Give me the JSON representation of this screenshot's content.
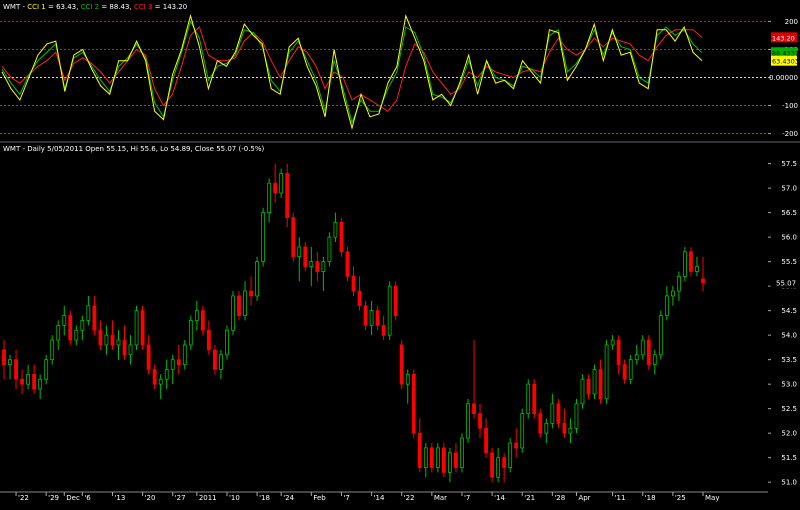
{
  "chart_data": [
    {
      "type": "line",
      "title_parts": [
        {
          "text": "WMT - ",
          "color": "#ffffff"
        },
        {
          "text": "CCI 1",
          "color": "#ffff00"
        },
        {
          "text": " = 63.43, ",
          "color": "#ffffff"
        },
        {
          "text": "CCI 2",
          "color": "#00c000"
        },
        {
          "text": " = 88.43, ",
          "color": "#ffffff"
        },
        {
          "text": "CCI 3",
          "color": "#ff2020"
        },
        {
          "text": " = 143.20",
          "color": "#ffffff"
        }
      ],
      "ylim": [
        -230,
        255
      ],
      "y_ticks": [
        "200",
        "100",
        "0.00000",
        "-100",
        "-200"
      ],
      "ref_lines": [
        {
          "value": 200,
          "color": "#ff2020"
        },
        {
          "value": 100,
          "color": "#ff2020"
        },
        {
          "value": 0,
          "color": "#ffffff"
        },
        {
          "value": -100,
          "color": "#00c000"
        },
        {
          "value": -200,
          "color": "#00c000"
        }
      ],
      "last_value_tags": [
        {
          "text": "143.20",
          "value": 143.2,
          "bg": "#e00000",
          "fg": "#ffffff"
        },
        {
          "text": "88.4337",
          "value": 90,
          "bg": "#00b000",
          "fg": "#000000"
        },
        {
          "text": "63.4303",
          "value": 60,
          "bg": "#ffff00",
          "fg": "#000000"
        }
      ],
      "series": [
        {
          "name": "CCI 1",
          "color": "#ffff00",
          "values": [
            20,
            -40,
            -80,
            0,
            80,
            120,
            130,
            -50,
            80,
            100,
            30,
            -30,
            -60,
            60,
            60,
            130,
            60,
            -120,
            -150,
            10,
            100,
            220,
            110,
            -40,
            60,
            40,
            90,
            190,
            150,
            120,
            -40,
            -60,
            110,
            140,
            40,
            -30,
            -140,
            100,
            -60,
            -180,
            -60,
            -140,
            -130,
            -20,
            40,
            220,
            140,
            60,
            -80,
            -60,
            -100,
            -20,
            80,
            -60,
            60,
            -20,
            -10,
            -40,
            60,
            20,
            -20,
            170,
            160,
            -10,
            40,
            100,
            190,
            60,
            170,
            80,
            90,
            -20,
            -40,
            170,
            170,
            130,
            180,
            90,
            60
          ]
        },
        {
          "name": "CCI 2",
          "color": "#00c000",
          "values": [
            30,
            -20,
            -60,
            10,
            60,
            90,
            120,
            -40,
            70,
            90,
            40,
            -10,
            -50,
            40,
            70,
            120,
            70,
            -90,
            -140,
            -10,
            90,
            200,
            140,
            -10,
            40,
            50,
            80,
            170,
            160,
            110,
            -10,
            -50,
            90,
            130,
            60,
            -10,
            -120,
            60,
            -40,
            -160,
            -80,
            -120,
            -120,
            -40,
            20,
            180,
            160,
            80,
            -60,
            -70,
            -90,
            -30,
            60,
            -30,
            60,
            0,
            -10,
            -30,
            40,
            30,
            0,
            150,
            170,
            20,
            50,
            100,
            170,
            80,
            160,
            110,
            100,
            0,
            -20,
            150,
            180,
            150,
            170,
            120,
            88
          ]
        },
        {
          "name": "CCI 3",
          "color": "#ff2020",
          "values": [
            40,
            0,
            -20,
            10,
            40,
            60,
            90,
            -10,
            50,
            70,
            50,
            20,
            -20,
            20,
            60,
            100,
            80,
            -40,
            -100,
            -60,
            40,
            150,
            180,
            80,
            60,
            60,
            70,
            130,
            160,
            130,
            60,
            0,
            60,
            110,
            90,
            40,
            -40,
            20,
            0,
            -80,
            -60,
            -80,
            -100,
            -120,
            -80,
            40,
            120,
            90,
            20,
            -20,
            -60,
            -40,
            20,
            0,
            40,
            20,
            10,
            0,
            20,
            30,
            20,
            90,
            140,
            100,
            80,
            100,
            140,
            110,
            140,
            130,
            120,
            80,
            60,
            110,
            150,
            170,
            170,
            170,
            143
          ]
        }
      ]
    },
    {
      "type": "candlestick",
      "title": "WMT - Daily 5/05/2011 Open 55.15, Hi 55.6, Lo 54.89, Close 55.07 (-0.5%)",
      "ylim": [
        50.8,
        57.9
      ],
      "y_ticks": [
        "57.5",
        "57.0",
        "56.5",
        "56.0",
        "55.5",
        "55.0",
        "54.5",
        "54.0",
        "53.5",
        "53.0",
        "52.5",
        "52.0",
        "51.5",
        "51.0"
      ],
      "last_price": 55.07,
      "last_price_label": "55.07",
      "x_ticks": [
        {
          "label": "'22",
          "index": 2
        },
        {
          "label": "'29",
          "index": 7
        },
        {
          "label": "Dec",
          "index": 10
        },
        {
          "label": "'6",
          "index": 13
        },
        {
          "label": "'13",
          "index": 18
        },
        {
          "label": "'20",
          "index": 23
        },
        {
          "label": "'27",
          "index": 28
        },
        {
          "label": "2011",
          "index": 32
        },
        {
          "label": "'10",
          "index": 37
        },
        {
          "label": "'18",
          "index": 42
        },
        {
          "label": "'24",
          "index": 46
        },
        {
          "label": "Feb",
          "index": 51
        },
        {
          "label": "'7",
          "index": 56
        },
        {
          "label": "'14",
          "index": 61
        },
        {
          "label": "'22",
          "index": 66
        },
        {
          "label": "Mar",
          "index": 71
        },
        {
          "label": "'7",
          "index": 76
        },
        {
          "label": "'14",
          "index": 81
        },
        {
          "label": "'21",
          "index": 86
        },
        {
          "label": "'28",
          "index": 91
        },
        {
          "label": "Apr",
          "index": 95
        },
        {
          "label": "'11",
          "index": 101
        },
        {
          "label": "'18",
          "index": 106
        },
        {
          "label": "'25",
          "index": 111
        },
        {
          "label": "May",
          "index": 116
        }
      ],
      "ohlc": [
        [
          53.7,
          53.9,
          53.1,
          53.4
        ],
        [
          53.4,
          53.6,
          53.1,
          53.5
        ],
        [
          53.5,
          53.7,
          52.9,
          53.1
        ],
        [
          53.1,
          53.3,
          52.8,
          53.0
        ],
        [
          53.0,
          53.4,
          52.9,
          53.2
        ],
        [
          53.2,
          53.4,
          52.8,
          52.9
        ],
        [
          52.9,
          53.2,
          52.7,
          53.1
        ],
        [
          53.1,
          53.6,
          53.0,
          53.5
        ],
        [
          53.5,
          54.0,
          53.4,
          53.9
        ],
        [
          53.9,
          54.3,
          53.7,
          54.2
        ],
        [
          54.2,
          54.6,
          54.0,
          54.4
        ],
        [
          54.4,
          54.5,
          53.8,
          53.9
        ],
        [
          53.9,
          54.2,
          53.8,
          54.1
        ],
        [
          54.1,
          54.4,
          53.9,
          54.3
        ],
        [
          54.3,
          54.8,
          54.2,
          54.6
        ],
        [
          54.6,
          54.8,
          54.0,
          54.1
        ],
        [
          54.1,
          54.3,
          53.7,
          53.8
        ],
        [
          53.8,
          54.2,
          53.6,
          54.0
        ],
        [
          54.0,
          54.3,
          53.7,
          53.8
        ],
        [
          53.8,
          54.1,
          53.5,
          53.9
        ],
        [
          53.9,
          54.2,
          53.5,
          53.6
        ],
        [
          53.6,
          54.0,
          53.4,
          53.8
        ],
        [
          53.8,
          54.6,
          53.7,
          54.5
        ],
        [
          54.5,
          54.6,
          53.7,
          53.8
        ],
        [
          53.8,
          54.0,
          53.2,
          53.3
        ],
        [
          53.3,
          53.4,
          52.9,
          53.0
        ],
        [
          53.0,
          53.2,
          52.7,
          53.1
        ],
        [
          53.1,
          53.5,
          52.9,
          53.3
        ],
        [
          53.3,
          53.6,
          53.0,
          53.5
        ],
        [
          53.5,
          53.8,
          53.2,
          53.4
        ],
        [
          53.4,
          53.9,
          53.3,
          53.8
        ],
        [
          53.8,
          54.4,
          53.7,
          54.3
        ],
        [
          54.3,
          54.7,
          54.1,
          54.5
        ],
        [
          54.5,
          54.6,
          54.0,
          54.1
        ],
        [
          54.1,
          54.3,
          53.6,
          53.7
        ],
        [
          53.7,
          53.8,
          53.2,
          53.3
        ],
        [
          53.3,
          53.7,
          53.1,
          53.6
        ],
        [
          53.6,
          54.2,
          53.5,
          54.1
        ],
        [
          54.1,
          54.9,
          54.0,
          54.8
        ],
        [
          54.8,
          54.9,
          54.3,
          54.4
        ],
        [
          54.4,
          55.1,
          54.3,
          54.9
        ],
        [
          54.9,
          55.2,
          54.6,
          54.8
        ],
        [
          54.8,
          55.6,
          54.7,
          55.5
        ],
        [
          55.5,
          56.6,
          55.4,
          56.5
        ],
        [
          56.5,
          57.2,
          56.3,
          57.1
        ],
        [
          57.1,
          57.5,
          56.7,
          56.9
        ],
        [
          56.9,
          57.4,
          56.8,
          57.3
        ],
        [
          57.3,
          57.5,
          56.2,
          56.4
        ],
        [
          56.4,
          56.5,
          55.5,
          55.6
        ],
        [
          55.6,
          56.0,
          55.1,
          55.8
        ],
        [
          55.8,
          55.9,
          55.3,
          55.4
        ],
        [
          55.4,
          55.8,
          55.0,
          55.5
        ],
        [
          55.5,
          55.7,
          55.1,
          55.3
        ],
        [
          55.3,
          55.6,
          54.9,
          55.5
        ],
        [
          55.5,
          56.1,
          55.4,
          56.0
        ],
        [
          56.0,
          56.5,
          55.9,
          56.3
        ],
        [
          56.3,
          56.4,
          55.6,
          55.7
        ],
        [
          55.7,
          55.8,
          55.1,
          55.2
        ],
        [
          55.2,
          55.4,
          54.8,
          54.9
        ],
        [
          54.9,
          55.2,
          54.5,
          54.6
        ],
        [
          54.6,
          54.7,
          54.1,
          54.2
        ],
        [
          54.2,
          54.7,
          54.0,
          54.5
        ],
        [
          54.5,
          54.6,
          54.1,
          54.2
        ],
        [
          54.2,
          54.4,
          53.9,
          54.0
        ],
        [
          54.0,
          55.1,
          53.9,
          55.0
        ],
        [
          55.0,
          55.1,
          54.3,
          54.4
        ],
        [
          53.8,
          53.9,
          52.9,
          53.0
        ],
        [
          53.0,
          53.3,
          52.6,
          53.2
        ],
        [
          53.2,
          53.3,
          51.9,
          52.0
        ],
        [
          52.0,
          52.3,
          51.2,
          51.3
        ],
        [
          51.3,
          51.8,
          51.1,
          51.7
        ],
        [
          51.7,
          51.8,
          51.2,
          51.3
        ],
        [
          51.3,
          51.8,
          51.2,
          51.7
        ],
        [
          51.7,
          51.8,
          51.1,
          51.2
        ],
        [
          51.2,
          51.7,
          51.0,
          51.6
        ],
        [
          51.6,
          51.8,
          51.2,
          51.3
        ],
        [
          51.3,
          52.0,
          51.2,
          51.9
        ],
        [
          51.9,
          52.7,
          51.8,
          52.6
        ],
        [
          52.6,
          53.9,
          52.3,
          52.4
        ],
        [
          52.4,
          52.6,
          51.9,
          52.1
        ],
        [
          52.1,
          52.3,
          51.5,
          51.6
        ],
        [
          51.6,
          51.7,
          51.0,
          51.1
        ],
        [
          51.1,
          51.7,
          51.0,
          51.5
        ],
        [
          51.5,
          51.6,
          51.0,
          51.3
        ],
        [
          51.3,
          51.9,
          51.2,
          51.8
        ],
        [
          51.8,
          52.1,
          51.5,
          51.7
        ],
        [
          51.7,
          52.5,
          51.6,
          52.4
        ],
        [
          52.4,
          53.1,
          52.3,
          53.0
        ],
        [
          53.0,
          53.1,
          52.3,
          52.4
        ],
        [
          52.4,
          52.5,
          51.9,
          52.0
        ],
        [
          52.0,
          52.3,
          51.8,
          52.2
        ],
        [
          52.2,
          52.8,
          52.1,
          52.6
        ],
        [
          52.6,
          52.7,
          52.1,
          52.2
        ],
        [
          52.2,
          52.5,
          51.9,
          52.0
        ],
        [
          52.0,
          52.3,
          51.8,
          52.1
        ],
        [
          52.1,
          52.7,
          52.0,
          52.6
        ],
        [
          52.6,
          53.2,
          52.5,
          53.1
        ],
        [
          53.1,
          53.2,
          52.7,
          52.8
        ],
        [
          52.8,
          53.4,
          52.7,
          53.3
        ],
        [
          53.3,
          53.5,
          52.6,
          52.7
        ],
        [
          52.7,
          53.9,
          52.6,
          53.8
        ],
        [
          53.8,
          54.0,
          53.7,
          53.9
        ],
        [
          53.9,
          54.0,
          53.2,
          53.4
        ],
        [
          53.4,
          53.5,
          53.0,
          53.1
        ],
        [
          53.1,
          53.6,
          53.0,
          53.5
        ],
        [
          53.5,
          53.8,
          53.4,
          53.6
        ],
        [
          53.6,
          54.0,
          53.5,
          53.9
        ],
        [
          53.9,
          54.0,
          53.3,
          53.4
        ],
        [
          53.4,
          53.7,
          53.2,
          53.6
        ],
        [
          53.6,
          54.5,
          53.5,
          54.4
        ],
        [
          54.4,
          55.0,
          54.3,
          54.8
        ],
        [
          54.8,
          55.0,
          54.6,
          54.9
        ],
        [
          54.9,
          55.3,
          54.7,
          55.2
        ],
        [
          55.2,
          55.8,
          55.1,
          55.7
        ],
        [
          55.7,
          55.8,
          55.2,
          55.3
        ],
        [
          55.3,
          55.6,
          55.2,
          55.4
        ],
        [
          55.15,
          55.6,
          54.89,
          55.07
        ]
      ]
    }
  ]
}
